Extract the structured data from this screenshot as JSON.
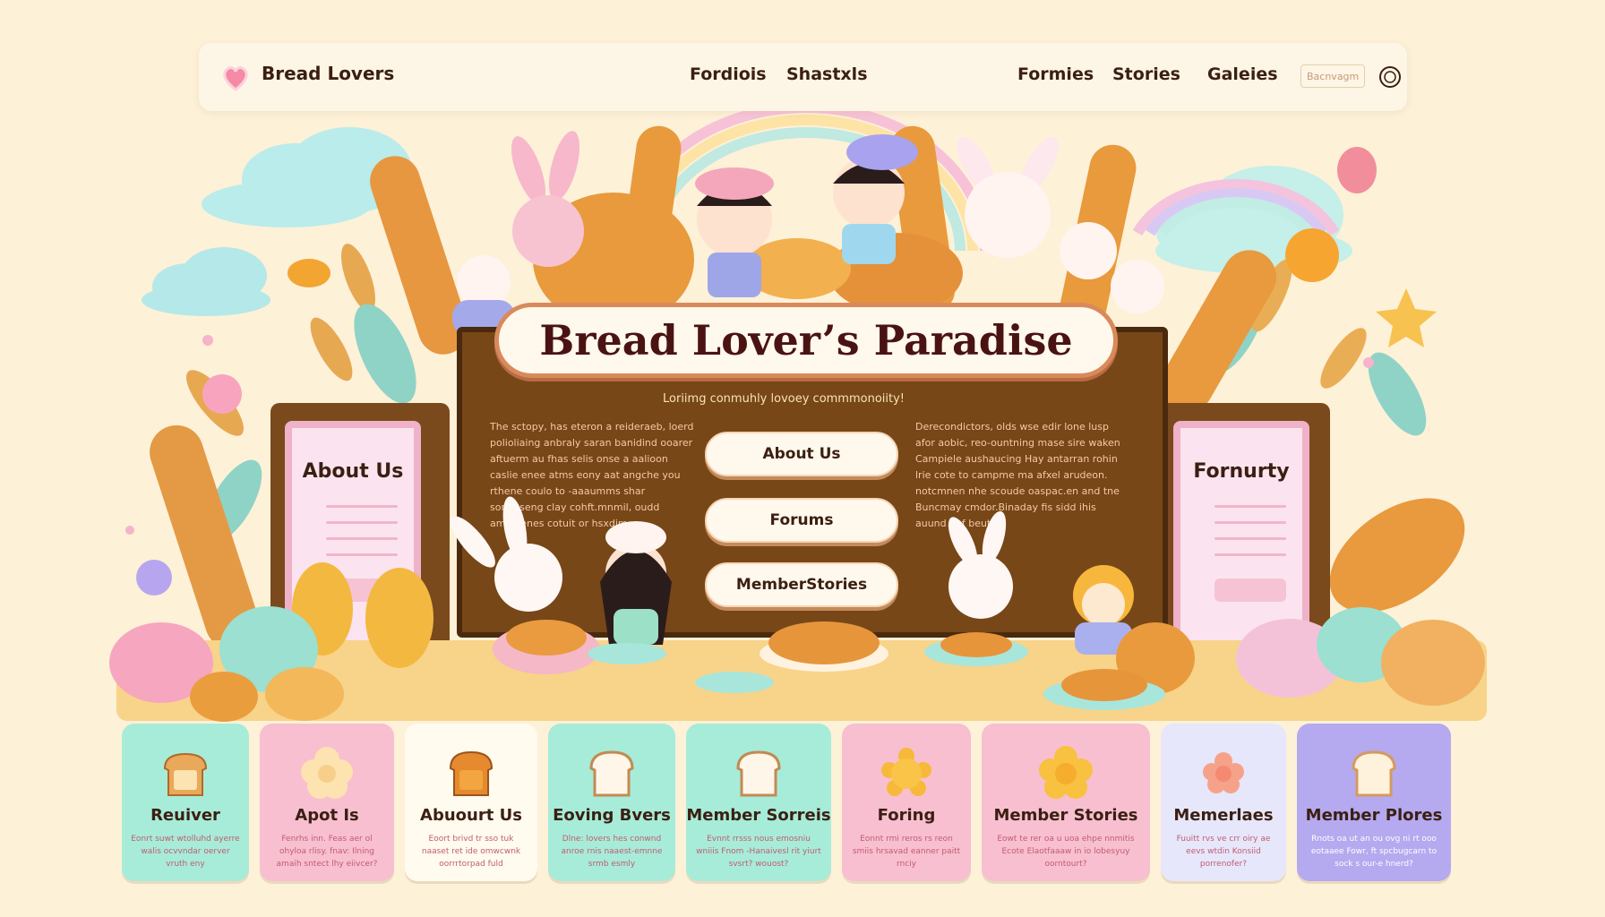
{
  "nav": {
    "brand": "Bread Lovers",
    "links": [
      "Fordiois",
      "Shastxls",
      "Formies",
      "Stories",
      "Galeies"
    ],
    "search_placeholder": "Bacnvagm"
  },
  "hero": {
    "title": "Bread Lover’s Paradise",
    "tagline": "Loriimg conmuhly lovoey     commmonoiity!",
    "left_text": "The sctopy, has eteron a reideraeb, loerd polioliaing anbraly saran banidind ooarer aftuerm au fhas selis onse a aalioon caslie enee atms eony aat angche you rthene coulo to -aaaumms shar sonanseng clay cohft.mnmil, oudd amesrenes cotuit or hsxdim.",
    "right_text": "Derecondictors, olds wse edir lone lusp afor aobic, reo-ountning mase sire waken Campiele aushaucing Hay antarran rohin lrie cote to campme ma afxel arudeon. notcmnen nhe scoude oaspac.en and tne Buncmay cmdor.Binaday fis sidd ihis auund onf beut."
  },
  "pills": [
    "About Us",
    "Forums",
    "MemberStories"
  ],
  "panels": {
    "left_title": "About Us",
    "right_title": "Fornurty"
  },
  "cards": [
    {
      "title": "Reuiver",
      "text": "Eonrt suwt wtolluhd ayerre walis ocvvndar oerver vruth eny",
      "icon": "toast-icon"
    },
    {
      "title": "Apot Is",
      "text": "Fenrhs inn. Feas aer ol ohyloa rlisy. fnav: Ilning amaih sntect lhy eiivcer?",
      "icon": "cookie-flower-icon"
    },
    {
      "title": "Abuourt Us",
      "text": "Eoort brivd tr sso tuk naaset ret ide omwcwnk oorrrtorpad fuld",
      "icon": "toast-icon"
    },
    {
      "title": "Eoving Bvers",
      "text": "Dlne: lovers hes conwnd anroe rnis naaest-emnne srmb esmly",
      "icon": "bread-slice-icon"
    },
    {
      "title": "Member Sorreis",
      "text": "Evnnt rrsss nous emosniu wniiis Fnom -Hanaivesl rit yiurt svsrt? wouost?",
      "icon": "bread-slice-icon"
    },
    {
      "title": "Foring",
      "text": "Eonnt rmi  reros rs reon smiis hrsavad eanner paitt rnciy",
      "icon": "sun-bun-icon"
    },
    {
      "title": "Member Stories",
      "text": "Eowt te rer oa u uoa ehpe nnmitis Ecote Elaotfaaaw in io lobesyuy oorntourt?",
      "icon": "cookie-flower-icon"
    },
    {
      "title": "Memerlaes",
      "text": "Fuuitt rvs ve  crr oiry ae  eevs wtdin Konsiid porrenofer?",
      "icon": "flower-icon"
    },
    {
      "title": "Member Plores",
      "text": "Rnots oa ut  an ou ovg ni rt ooo eotaaee Fowr, ft spcbugcarn to sock s our-e hnerd?",
      "icon": "bread-slice-icon"
    }
  ],
  "colors": {
    "background": "#fdf1d8",
    "board": "#774718",
    "title_text": "#4a1313",
    "card_mint": "#a7ecd8",
    "card_pink": "#f8bfd0",
    "card_cream": "#fffbee",
    "card_lavender": "#e6e7fb",
    "card_purple": "#b5a9f0"
  }
}
